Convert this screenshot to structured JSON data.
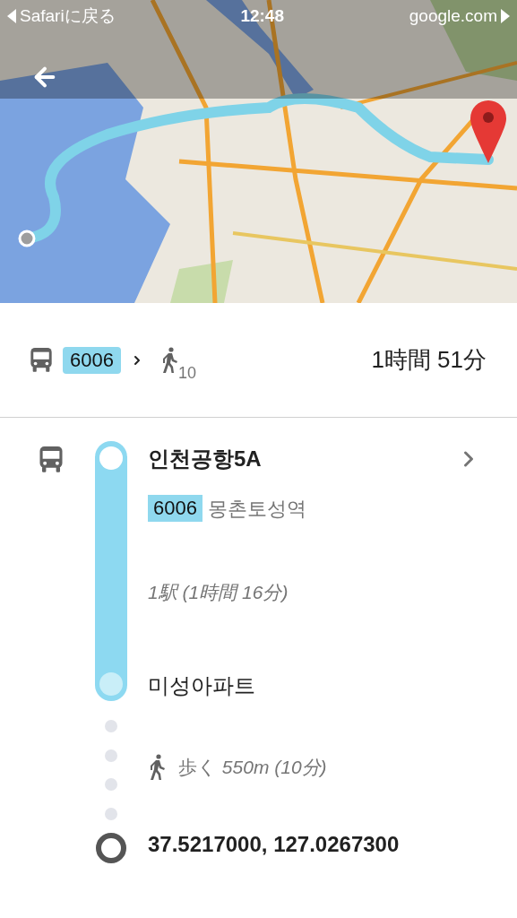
{
  "status_bar": {
    "back_label": "Safariに戻る",
    "time": "12:48",
    "url": "google.com"
  },
  "summary": {
    "segments": [
      {
        "kind": "bus",
        "route": "6006"
      },
      {
        "kind": "walk",
        "minutes": "10"
      }
    ],
    "duration": "1時間 51分"
  },
  "transit": {
    "departure_stop": "인천공항5A",
    "route": "6006",
    "headsign": "몽촌토성역",
    "stops_info": "1駅 (1時間 16分)",
    "arrival_stop": "미성아파트"
  },
  "walk": {
    "text": "歩く *550m (10分)*"
  },
  "destination": "37.5217000, 127.0267300"
}
